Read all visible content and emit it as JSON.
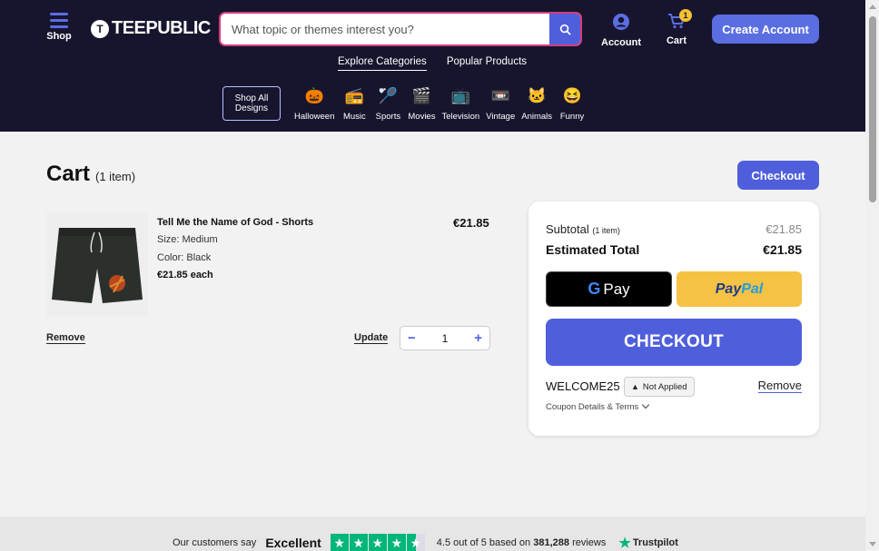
{
  "header": {
    "shop_label": "Shop",
    "logo_text": "TEEPUBLIC",
    "logo_mark": "T",
    "search_placeholder": "What topic or themes interest you?",
    "account_label": "Account",
    "cart_label": "Cart",
    "cart_count": "1",
    "create_account_label": "Create Account"
  },
  "nav": {
    "tabs": [
      "Explore Categories",
      "Popular Products"
    ],
    "shop_all": "Shop All Designs",
    "categories": [
      {
        "label": "Halloween",
        "icon": "pumpkin-icon",
        "glyph": "🎃"
      },
      {
        "label": "Music",
        "icon": "boombox-icon",
        "glyph": "📻"
      },
      {
        "label": "Sports",
        "icon": "racket-icon",
        "glyph": "🏸"
      },
      {
        "label": "Movies",
        "icon": "clapperboard-icon",
        "glyph": "🎬"
      },
      {
        "label": "Television",
        "icon": "tv-icon",
        "glyph": "📺"
      },
      {
        "label": "Vintage",
        "icon": "cassette-icon",
        "glyph": "📼"
      },
      {
        "label": "Animals",
        "icon": "cat-icon",
        "glyph": "🐱"
      },
      {
        "label": "Funny",
        "icon": "laughing-face-icon",
        "glyph": "😆"
      }
    ]
  },
  "cart": {
    "title": "Cart",
    "count_text": "(1 item)",
    "checkout_label": "Checkout",
    "item": {
      "name": "Tell Me the Name of God - Shorts",
      "size": "Size: Medium",
      "color": "Color: Black",
      "each": "€21.85 each",
      "price": "€21.85",
      "remove_label": "Remove",
      "update_label": "Update",
      "quantity": "1",
      "minus": "−",
      "plus": "+"
    }
  },
  "summary": {
    "subtotal_label": "Subtotal",
    "subtotal_count": "(1 item)",
    "subtotal_value": "€21.85",
    "estimated_label": "Estimated Total",
    "estimated_value": "€21.85",
    "gpay_g": "G",
    "gpay_label": "Pay",
    "paypal_1": "Pay",
    "paypal_2": "Pal",
    "checkout_label": "CHECKOUT",
    "coupon_code": "WELCOME25",
    "coupon_status": "Not Applied",
    "coupon_remove": "Remove",
    "coupon_terms": "Coupon Details & Terms"
  },
  "trust": {
    "say": "Our customers say",
    "excellent": "Excellent",
    "rating_text": "4.5 out of 5 based on",
    "reviews": "381,288",
    "reviews_word": "reviews",
    "brand": "Trustpilot",
    "stars": 4.5
  },
  "colors": {
    "header_bg": "#17152e",
    "accent": "#4f5fdc",
    "trustpilot_green": "#00b67a",
    "paypal_yellow": "#f6c244"
  }
}
